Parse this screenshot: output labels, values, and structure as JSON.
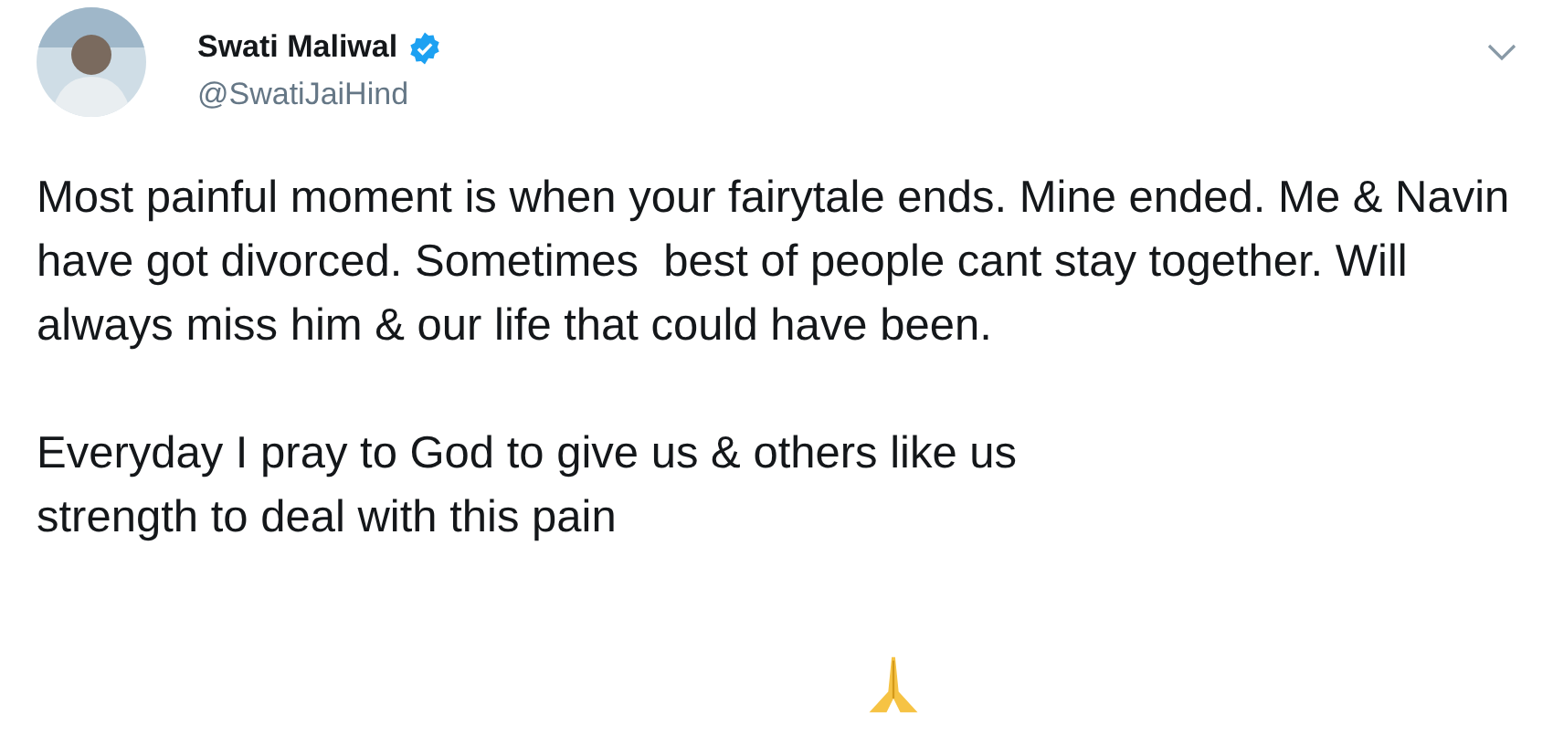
{
  "author": {
    "name": "Swati Maliwal",
    "verified": true,
    "handle": "@SwatiJaiHind"
  },
  "paragraphs": [
    "Most painful moment is when your fairytale ends. Mine ended. Me & Navin have got divorced. Sometimes  best of people cant stay together. Will always miss him & our life that could have been.",
    "Everyday I pray to God to give us & others like us strength to deal with this pain"
  ]
}
